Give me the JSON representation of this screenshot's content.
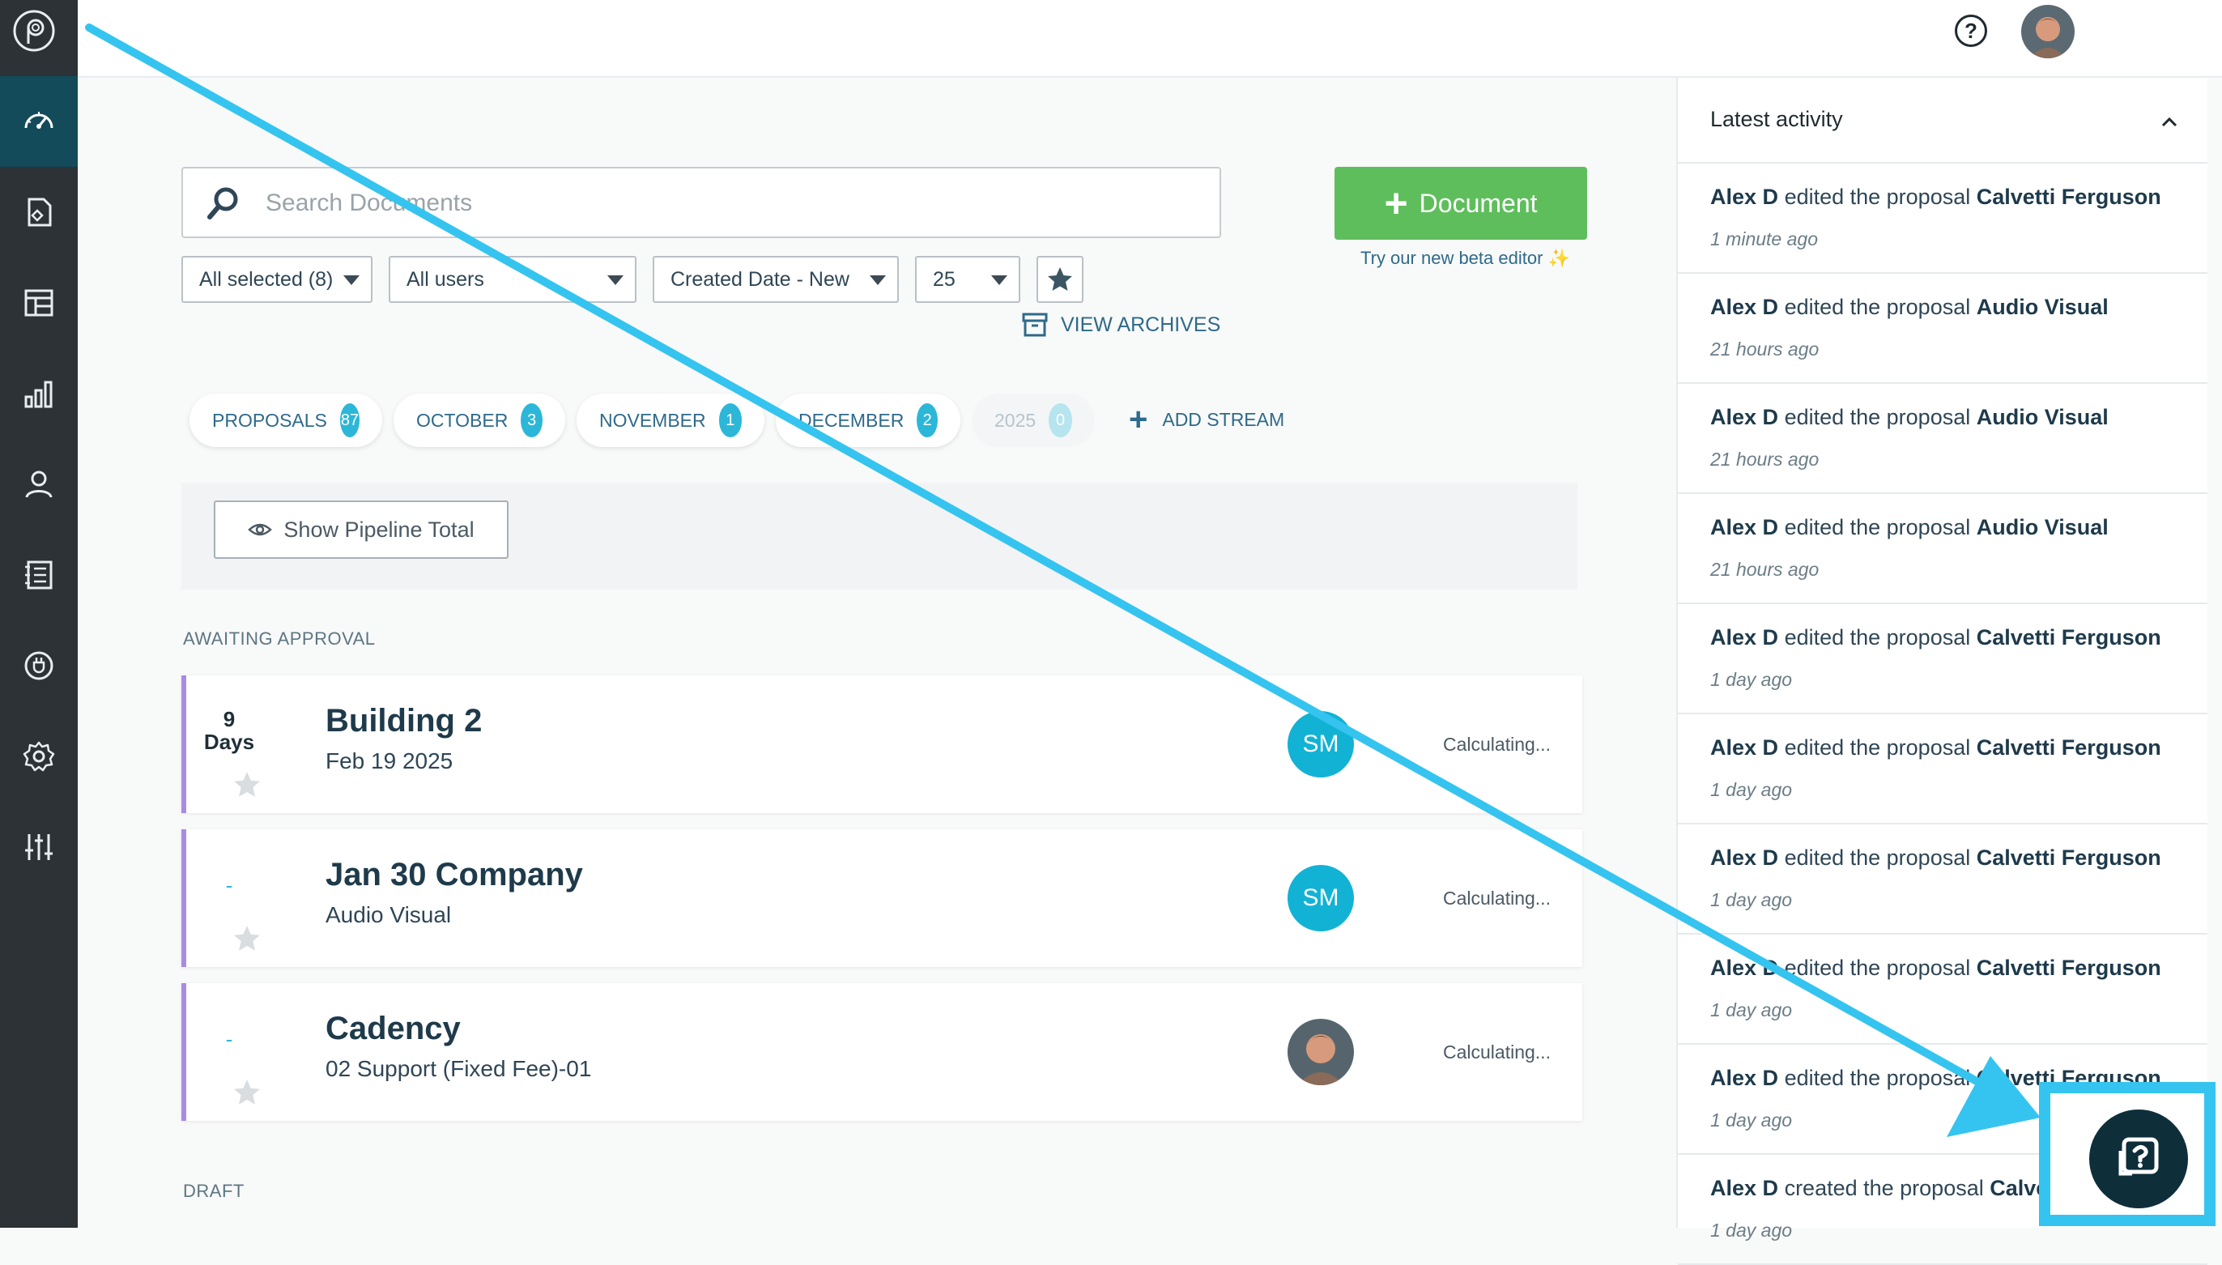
{
  "topbar": {
    "help_icon": "?"
  },
  "search": {
    "placeholder": "Search Documents"
  },
  "new_document": {
    "label": "Document",
    "plus": "+"
  },
  "beta_link": {
    "label": "Try our new beta editor ✨"
  },
  "filters": {
    "status": "All selected (8)",
    "users": "All users",
    "sort": "Created Date - New",
    "per_page": "25"
  },
  "view_archives": {
    "label": "VIEW ARCHIVES"
  },
  "streams": [
    {
      "label": "PROPOSALS",
      "count": "87"
    },
    {
      "label": "OCTOBER",
      "count": "3"
    },
    {
      "label": "NOVEMBER",
      "count": "1"
    },
    {
      "label": "DECEMBER",
      "count": "2"
    },
    {
      "label": "2025",
      "count": "0"
    }
  ],
  "add_stream": {
    "label": "ADD STREAM"
  },
  "pipeline": {
    "label": "Show Pipeline Total"
  },
  "sections": {
    "awaiting": "AWAITING APPROVAL",
    "draft": "DRAFT"
  },
  "cards": [
    {
      "days": "9",
      "days_label": "Days",
      "title": "Building 2",
      "subtitle": "Feb 19 2025",
      "initials": "SM",
      "value": "Calculating..."
    },
    {
      "days": "-",
      "title": "Jan 30 Company",
      "subtitle": "Audio Visual",
      "initials": "SM",
      "value": "Calculating..."
    },
    {
      "days": "-",
      "title": "Cadency",
      "subtitle": "02 Support (Fixed Fee)-01",
      "value": "Calculating..."
    }
  ],
  "activity": {
    "title": "Latest activity",
    "items": [
      {
        "user": "Alex D",
        "action": "edited the proposal",
        "doc": "Calvetti Ferguson",
        "time": "1 minute ago"
      },
      {
        "user": "Alex D",
        "action": "edited the proposal",
        "doc": "Audio Visual",
        "time": "21 hours ago"
      },
      {
        "user": "Alex D",
        "action": "edited the proposal",
        "doc": "Audio Visual",
        "time": "21 hours ago"
      },
      {
        "user": "Alex D",
        "action": "edited the proposal",
        "doc": "Audio Visual",
        "time": "21 hours ago"
      },
      {
        "user": "Alex D",
        "action": "edited the proposal",
        "doc": "Calvetti Ferguson",
        "time": "1 day ago"
      },
      {
        "user": "Alex D",
        "action": "edited the proposal",
        "doc": "Calvetti Ferguson",
        "time": "1 day ago"
      },
      {
        "user": "Alex D",
        "action": "edited the proposal",
        "doc": "Calvetti Ferguson",
        "time": "1 day ago"
      },
      {
        "user": "Alex D",
        "action": "edited the proposal",
        "doc": "Calvetti Ferguson",
        "time": "1 day ago"
      },
      {
        "user": "Alex D",
        "action": "edited the proposal",
        "doc": "Calvetti Ferguson",
        "time": "1 day ago"
      },
      {
        "user": "Alex D",
        "action": "created the proposal",
        "doc": "Calvetti Ferguson",
        "time": "1 day ago"
      }
    ]
  },
  "colors": {
    "rail": "#2c3236",
    "rail_active": "#134b5a",
    "accent_teal": "#2cb7d8",
    "document_green": "#5fbe5c",
    "card_border": "#a98be4",
    "annotation_arrow": "#35c4ef"
  },
  "icons": {
    "rail": [
      "logo-icon",
      "dashboard-icon",
      "documents-icon",
      "templates-icon",
      "reports-icon",
      "contacts-icon",
      "catalog-icon",
      "integrations-icon",
      "settings-icon",
      "sliders-icon"
    ],
    "help_widget": "chat-help-icon"
  }
}
